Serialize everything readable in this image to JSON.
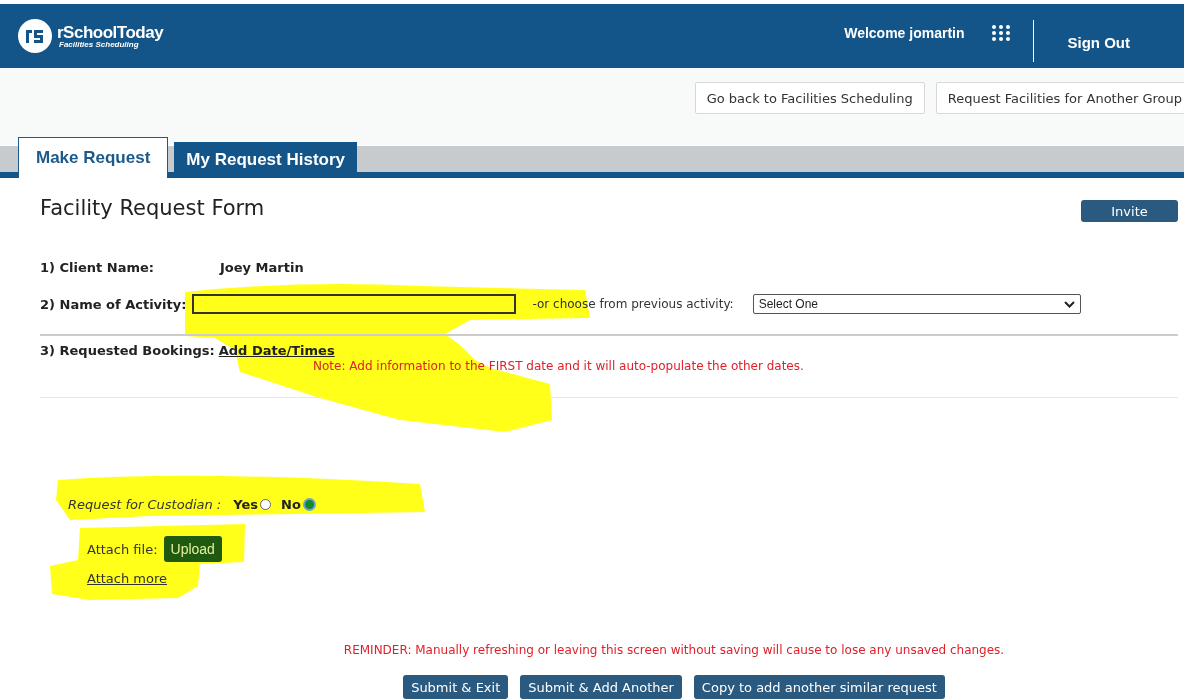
{
  "header": {
    "logo_text": "rSchoolToday",
    "logo_tagline": "Facilities Scheduling",
    "welcome": "Welcome jomartin",
    "sign_out": "Sign Out"
  },
  "top_buttons": [
    "Go back to Facilities Scheduling",
    "Request Facilities for Another Group"
  ],
  "tabs": [
    {
      "label": "Make Request",
      "selected": true
    },
    {
      "label": "My Request History",
      "selected": false
    }
  ],
  "form": {
    "title": "Facility Request Form",
    "invite": "Invite",
    "client": {
      "label": "1) Client Name:",
      "value": "Joey Martin"
    },
    "activity": {
      "label": "2) Name of Activity:",
      "alt_label": "-or choose from previous activity:",
      "select_value": "Select One"
    },
    "bookings": {
      "label": "3) Requested Bookings:",
      "link": "Add Date/Times",
      "note": "Note: Add information to the FIRST date and it will auto-populate the other dates."
    },
    "custodian": {
      "label": "Request for Custodian :",
      "options": [
        {
          "label": "Yes",
          "selected": false
        },
        {
          "label": "No",
          "selected": true
        }
      ]
    },
    "attach": {
      "label": "Attach file:",
      "button": "Upload",
      "more_link": "Attach more"
    },
    "reminder": "REMINDER: Manually refreshing or leaving this screen without saving will cause to lose any unsaved changes.",
    "actions": [
      "Submit & Exit",
      "Submit & Add Another",
      "Copy to add another similar request"
    ]
  }
}
